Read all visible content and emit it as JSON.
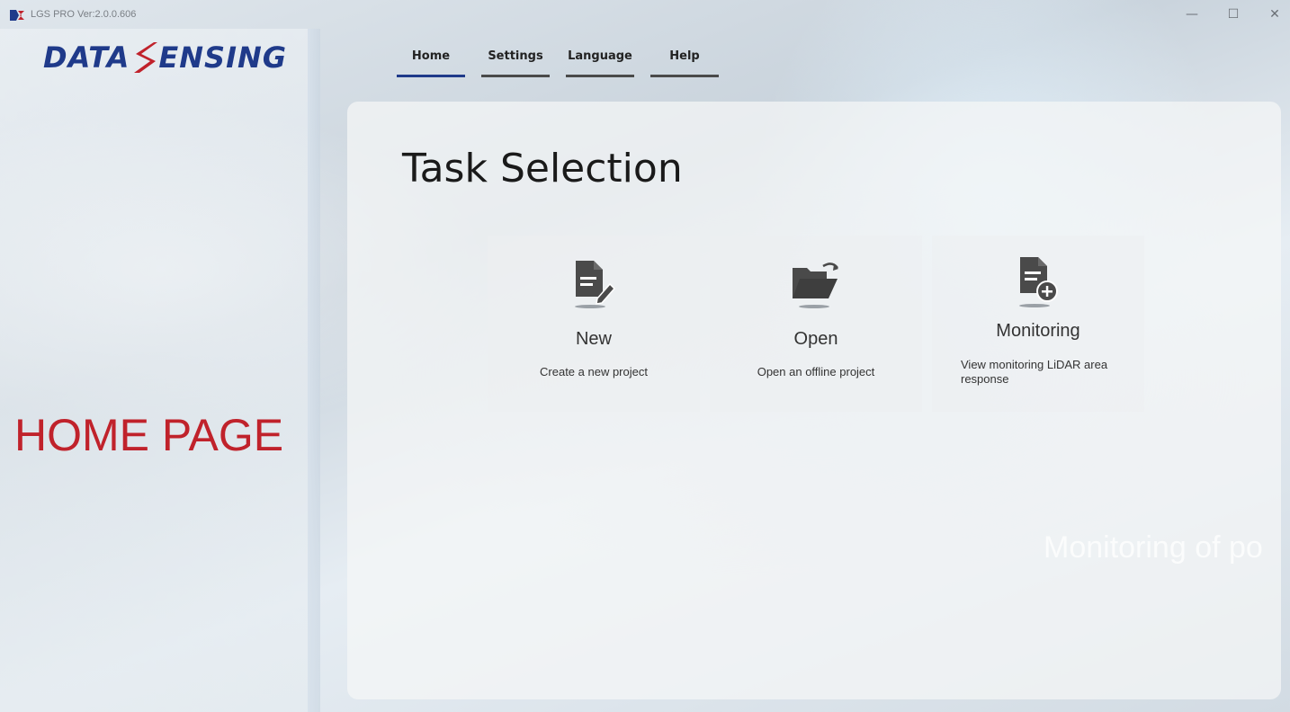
{
  "app": {
    "title": "LGS PRO  Ver:2.0.0.606"
  },
  "window_controls": {
    "minimize": "—",
    "maximize": "☐",
    "close": "✕"
  },
  "sidebar": {
    "logo_part1": "DATA",
    "logo_part2": "ENSING",
    "page_label": "HOME PAGE"
  },
  "nav": {
    "tabs": [
      {
        "label": "Home",
        "active": true
      },
      {
        "label": "Settings",
        "active": false
      },
      {
        "label": "Language",
        "active": false
      },
      {
        "label": "Help",
        "active": false
      }
    ]
  },
  "main": {
    "title": "Task Selection",
    "cards": [
      {
        "title": "New",
        "description": "Create a new project",
        "icon": "new-document-icon"
      },
      {
        "title": "Open",
        "description": "Open an offline project",
        "icon": "folder-open-icon"
      },
      {
        "title": "Monitoring",
        "description": "View monitoring LiDAR area response",
        "icon": "document-add-icon"
      }
    ],
    "background_caption": "Monitoring of po"
  },
  "colors": {
    "brand_blue": "#1f3a8a",
    "brand_red": "#c0222b",
    "active_tab_underline": "#1f3a8a",
    "tab_underline": "#4a4a4a"
  }
}
